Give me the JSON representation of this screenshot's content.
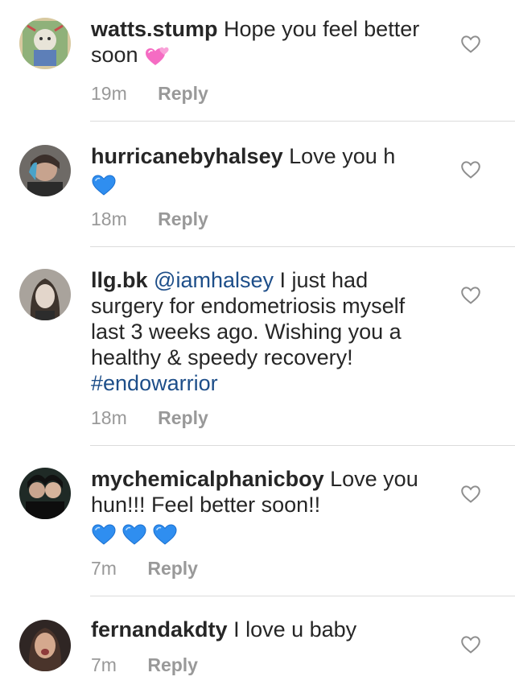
{
  "accent_colors": {
    "text": "#262626",
    "muted": "#999999",
    "link": "#1d4e89",
    "divider": "#dbdbdb",
    "blue_heart": "#2f8ef0",
    "pink_heart": "#f56cc3"
  },
  "comments": [
    {
      "username": "watts.stump",
      "text": "Hope you feel better soon",
      "emoji": "revolving-hearts-emoji",
      "time": "19m",
      "reply_label": "Reply"
    },
    {
      "username": "hurricanebyhalsey",
      "text": "Love you h",
      "emoji": "blue-heart-emoji",
      "time": "18m",
      "reply_label": "Reply"
    },
    {
      "username": "llg.bk",
      "mention": "@iamhalsey",
      "text": "I just had surgery for endometriosis myself last 3 weeks ago. Wishing you a healthy & speedy recovery!",
      "hashtag": "#endowarrior",
      "time": "18m",
      "reply_label": "Reply"
    },
    {
      "username": "mychemicalphanicboy",
      "text": "Love you hun!!! Feel better soon!!",
      "emoji": "blue-heart-emoji",
      "time": "7m",
      "reply_label": "Reply"
    },
    {
      "username": "fernandakdty",
      "text": "I love u baby",
      "time": "7m",
      "reply_label": "Reply"
    }
  ]
}
